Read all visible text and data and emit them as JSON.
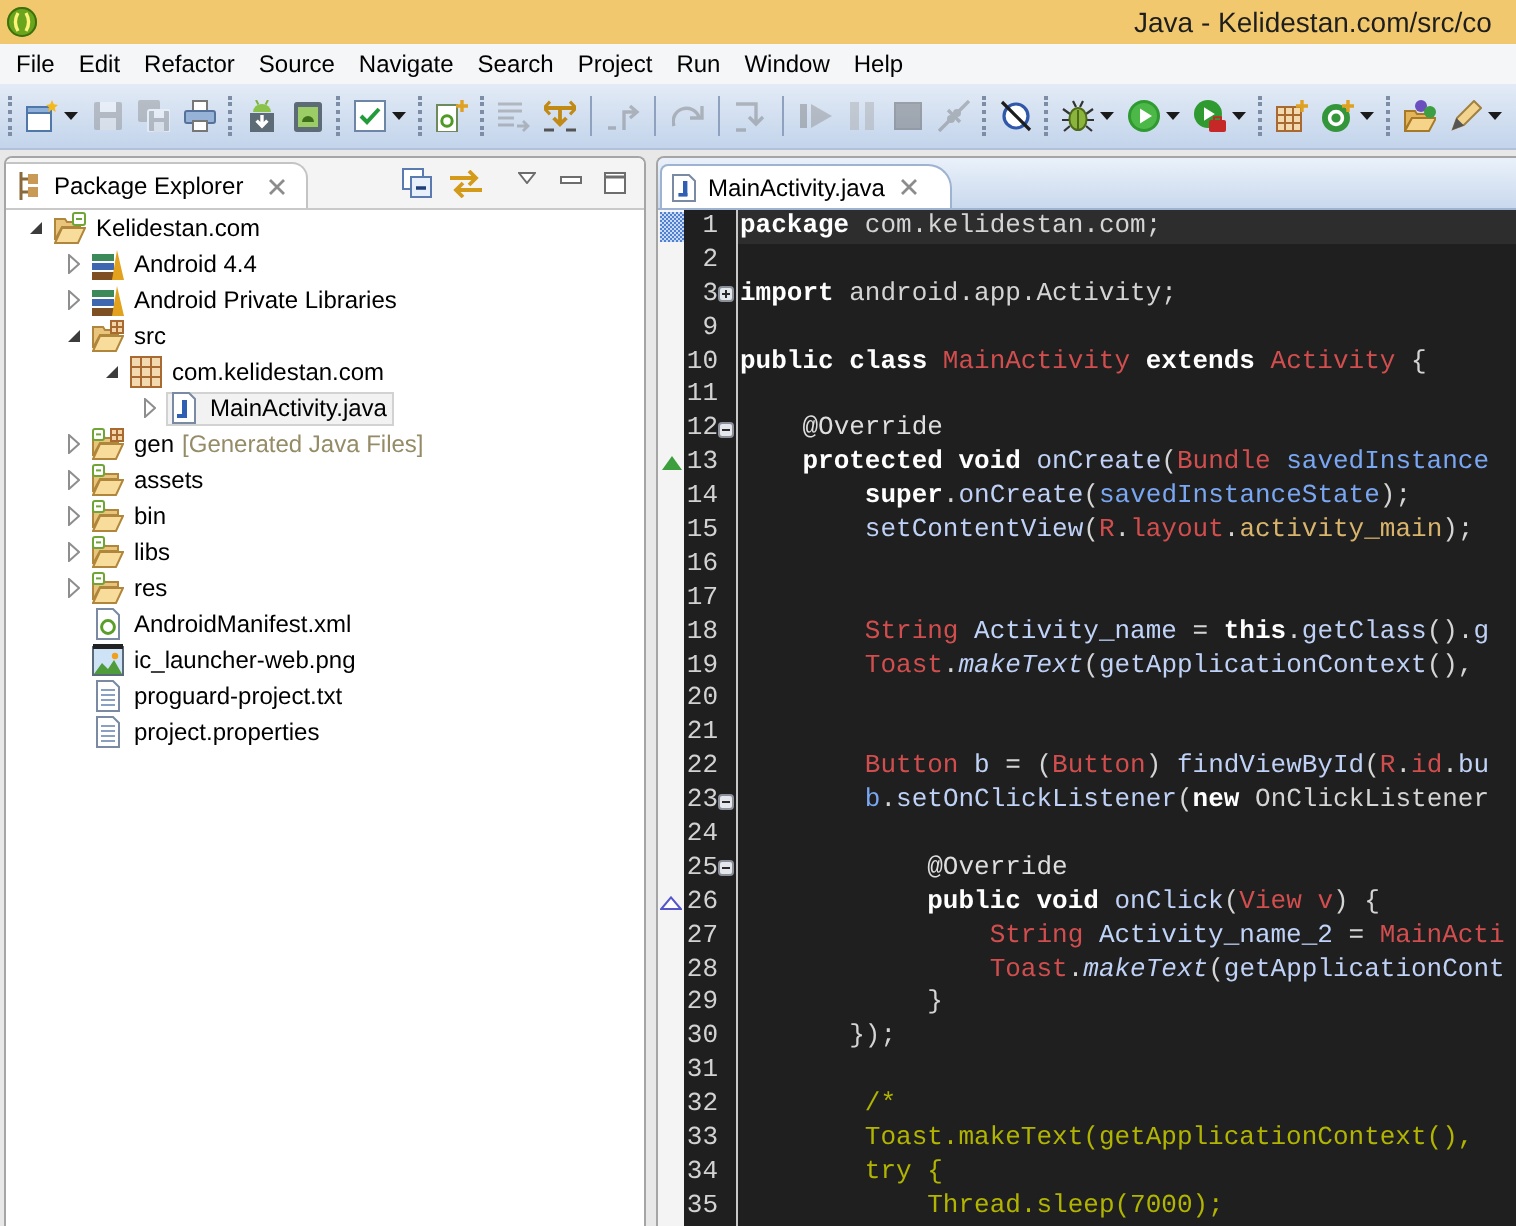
{
  "window": {
    "title": "Java - Kelidestan.com/src/co"
  },
  "menu": [
    "File",
    "Edit",
    "Refactor",
    "Source",
    "Navigate",
    "Search",
    "Project",
    "Run",
    "Window",
    "Help"
  ],
  "toolbar": {
    "groups": [
      {
        "kind": "grip",
        "items": [
          {
            "disabled": false,
            "menu": true
          },
          {
            "disabled": true
          },
          {
            "disabled": true
          },
          {
            "disabled": false
          }
        ]
      },
      {
        "kind": "grip",
        "items": [
          {
            "disabled": false
          },
          {
            "disabled": false
          }
        ]
      },
      {
        "kind": "grip",
        "items": [
          {
            "disabled": false,
            "menu": true
          }
        ]
      },
      {
        "kind": "grip",
        "items": [
          {
            "disabled": false
          }
        ]
      },
      {
        "kind": "grip",
        "items": [
          {
            "disabled": true
          },
          {
            "disabled": false
          }
        ]
      },
      {
        "kind": "line",
        "items": [
          {
            "disabled": true
          }
        ]
      },
      {
        "kind": "line",
        "items": [
          {
            "disabled": true
          }
        ]
      },
      {
        "kind": "line",
        "items": [
          {
            "disabled": true
          }
        ]
      },
      {
        "kind": "line",
        "items": [
          {
            "disabled": true
          },
          {
            "disabled": true
          },
          {
            "disabled": true
          },
          {
            "disabled": true
          }
        ]
      },
      {
        "kind": "grip",
        "items": [
          {
            "disabled": false
          }
        ]
      },
      {
        "kind": "grip",
        "items": [
          {
            "disabled": false,
            "menu": true
          },
          {
            "disabled": false,
            "menu": true
          },
          {
            "disabled": false,
            "menu": true
          }
        ]
      },
      {
        "kind": "grip",
        "items": [
          {
            "disabled": false
          },
          {
            "disabled": false,
            "menu": true
          }
        ]
      },
      {
        "kind": "grip",
        "items": [
          {
            "disabled": false
          },
          {
            "disabled": false,
            "menu": true
          }
        ]
      }
    ]
  },
  "package_explorer": {
    "active": false,
    "tabs": [
      {
        "label": "Package Explorer",
        "selected": true
      }
    ],
    "tree": [
      {
        "label": "Kelidestan.com",
        "kind": "project",
        "expanded": true,
        "selected": false,
        "children": [
          {
            "label": "Android 4.4",
            "kind": "library",
            "expanded": false,
            "selected": false
          },
          {
            "label": "Android Private Libraries",
            "kind": "library",
            "expanded": false,
            "selected": false
          },
          {
            "label": "src",
            "kind": "source-folder",
            "expanded": true,
            "selected": false,
            "children": [
              {
                "label": "com.kelidestan.com",
                "kind": "package",
                "expanded": true,
                "selected": false,
                "children": [
                  {
                    "label": "MainActivity.java",
                    "kind": "java-file",
                    "expanded": false,
                    "selected": true
                  }
                ]
              }
            ]
          },
          {
            "label": "gen",
            "decoration": "[Generated Java Files]",
            "kind": "generated-folder",
            "expanded": false,
            "selected": false
          },
          {
            "label": "assets",
            "kind": "folder",
            "expanded": false,
            "selected": false
          },
          {
            "label": "bin",
            "kind": "folder",
            "expanded": false,
            "selected": false
          },
          {
            "label": "libs",
            "kind": "folder",
            "expanded": false,
            "selected": false
          },
          {
            "label": "res",
            "kind": "folder",
            "expanded": false,
            "selected": false
          },
          {
            "label": "AndroidManifest.xml",
            "kind": "manifest",
            "selected": false
          },
          {
            "label": "ic_launcher-web.png",
            "kind": "image",
            "selected": false
          },
          {
            "label": "proguard-project.txt",
            "kind": "text-file",
            "selected": false
          },
          {
            "label": "project.properties",
            "kind": "text-file",
            "selected": false
          }
        ]
      }
    ]
  },
  "editor": {
    "active": true,
    "tabs": [
      {
        "label": "MainActivity.java",
        "selected": true
      }
    ],
    "lines": [
      {
        "number": "1",
        "kind": "checkered",
        "current": true,
        "tokens": [
          {
            "kind": "keyword",
            "text": "package "
          },
          {
            "kind": "plain",
            "text": "com.kelidestan.com;"
          }
        ]
      },
      {
        "number": "2",
        "kind": "plain",
        "current": false
      },
      {
        "number": "3",
        "kind": "plain",
        "current": false,
        "folded": true,
        "tokens": [
          {
            "kind": "keyword",
            "text": "import "
          },
          {
            "kind": "plain",
            "text": "android.app.Activity;"
          }
        ]
      },
      {
        "number": "9",
        "kind": "plain",
        "current": false
      },
      {
        "number": "10",
        "kind": "plain",
        "current": false,
        "tokens": [
          {
            "kind": "keyword",
            "text": "public "
          },
          {
            "kind": "keyword",
            "text": "class "
          },
          {
            "kind": "type",
            "text": "MainActivity "
          },
          {
            "kind": "keyword",
            "text": "extends "
          },
          {
            "kind": "type",
            "text": "Activity "
          },
          {
            "kind": "plain",
            "text": "{"
          }
        ]
      },
      {
        "number": "11",
        "kind": "plain",
        "current": false
      },
      {
        "number": "12",
        "kind": "plain",
        "current": false,
        "folded": false,
        "tokens": [
          {
            "kind": "annotation",
            "text": "    @Override"
          }
        ]
      },
      {
        "number": "13",
        "kind": "override",
        "current": false,
        "tokens": [
          {
            "kind": "keyword",
            "text": "    protected "
          },
          {
            "kind": "keyword",
            "text": "void "
          },
          {
            "kind": "method",
            "text": "onCreate"
          },
          {
            "kind": "plain",
            "text": "("
          },
          {
            "kind": "type",
            "text": "Bundle "
          },
          {
            "kind": "parameter",
            "text": "savedInstance"
          }
        ]
      },
      {
        "number": "14",
        "kind": "plain",
        "current": false,
        "tokens": [
          {
            "kind": "keyword",
            "text": "        super"
          },
          {
            "kind": "plain",
            "text": "."
          },
          {
            "kind": "method",
            "text": "onCreate"
          },
          {
            "kind": "plain",
            "text": "("
          },
          {
            "kind": "parameter",
            "text": "savedInstanceState"
          },
          {
            "kind": "plain",
            "text": ");"
          }
        ]
      },
      {
        "number": "15",
        "kind": "plain",
        "current": false,
        "tokens": [
          {
            "kind": "method",
            "text": "        setContentView"
          },
          {
            "kind": "plain",
            "text": "("
          },
          {
            "kind": "type",
            "text": "R"
          },
          {
            "kind": "plain",
            "text": "."
          },
          {
            "kind": "field",
            "text": "layout"
          },
          {
            "kind": "plain",
            "text": "."
          },
          {
            "kind": "constant",
            "text": "activity_main"
          },
          {
            "kind": "plain",
            "text": ");"
          }
        ]
      },
      {
        "number": "16",
        "kind": "plain",
        "current": false
      },
      {
        "number": "17",
        "kind": "plain",
        "current": false
      },
      {
        "number": "18",
        "kind": "plain",
        "current": false,
        "tokens": [
          {
            "kind": "type",
            "text": "        String "
          },
          {
            "kind": "local",
            "text": "Activity_name "
          },
          {
            "kind": "plain",
            "text": "= "
          },
          {
            "kind": "keyword",
            "text": "this"
          },
          {
            "kind": "plain",
            "text": "."
          },
          {
            "kind": "method",
            "text": "getClass"
          },
          {
            "kind": "plain",
            "text": "()."
          },
          {
            "kind": "method",
            "text": "g"
          }
        ]
      },
      {
        "number": "19",
        "kind": "plain",
        "current": false,
        "tokens": [
          {
            "kind": "type",
            "text": "        Toast"
          },
          {
            "kind": "plain",
            "text": "."
          },
          {
            "kind": "static_method",
            "text": "makeText"
          },
          {
            "kind": "plain",
            "text": "("
          },
          {
            "kind": "method",
            "text": "getApplicationContext"
          },
          {
            "kind": "plain",
            "text": "(),"
          }
        ]
      },
      {
        "number": "20",
        "kind": "plain",
        "current": false
      },
      {
        "number": "21",
        "kind": "plain",
        "current": false
      },
      {
        "number": "22",
        "kind": "plain",
        "current": false,
        "tokens": [
          {
            "kind": "type",
            "text": "        Button "
          },
          {
            "kind": "local",
            "text": "b "
          },
          {
            "kind": "plain",
            "text": "= ("
          },
          {
            "kind": "type",
            "text": "Button"
          },
          {
            "kind": "plain",
            "text": ") "
          },
          {
            "kind": "method",
            "text": "findViewById"
          },
          {
            "kind": "plain",
            "text": "("
          },
          {
            "kind": "type",
            "text": "R"
          },
          {
            "kind": "plain",
            "text": "."
          },
          {
            "kind": "field",
            "text": "id"
          },
          {
            "kind": "plain",
            "text": "."
          },
          {
            "kind": "local",
            "text": "bu"
          }
        ]
      },
      {
        "number": "23",
        "kind": "plain",
        "current": false,
        "folded": false,
        "tokens": [
          {
            "kind": "parameter",
            "text": "        b"
          },
          {
            "kind": "plain",
            "text": "."
          },
          {
            "kind": "method",
            "text": "setOnClickListener"
          },
          {
            "kind": "plain",
            "text": "("
          },
          {
            "kind": "keyword",
            "text": "new "
          },
          {
            "kind": "plain",
            "text": "OnClickListener"
          }
        ]
      },
      {
        "number": "24",
        "kind": "plain",
        "current": false
      },
      {
        "number": "25",
        "kind": "plain",
        "current": false,
        "folded": false,
        "tokens": [
          {
            "kind": "annotation",
            "text": "            @Override"
          }
        ]
      },
      {
        "number": "26",
        "kind": "implement",
        "current": false,
        "tokens": [
          {
            "kind": "keyword",
            "text": "            public "
          },
          {
            "kind": "keyword",
            "text": "void "
          },
          {
            "kind": "method",
            "text": "onClick"
          },
          {
            "kind": "plain",
            "text": "("
          },
          {
            "kind": "type",
            "text": "View "
          },
          {
            "kind": "type",
            "text": "v"
          },
          {
            "kind": "plain",
            "text": ") {"
          }
        ]
      },
      {
        "number": "27",
        "kind": "plain",
        "current": false,
        "tokens": [
          {
            "kind": "type",
            "text": "                String "
          },
          {
            "kind": "local",
            "text": "Activity_name_2 "
          },
          {
            "kind": "plain",
            "text": "= "
          },
          {
            "kind": "type",
            "text": "MainActi"
          }
        ]
      },
      {
        "number": "28",
        "kind": "plain",
        "current": false,
        "tokens": [
          {
            "kind": "type",
            "text": "                Toast"
          },
          {
            "kind": "plain",
            "text": "."
          },
          {
            "kind": "static_method",
            "text": "makeText"
          },
          {
            "kind": "plain",
            "text": "("
          },
          {
            "kind": "method",
            "text": "getApplicationCont"
          }
        ]
      },
      {
        "number": "29",
        "kind": "plain",
        "current": false,
        "tokens": [
          {
            "kind": "plain",
            "text": "            }"
          }
        ]
      },
      {
        "number": "30",
        "kind": "plain",
        "current": false,
        "tokens": [
          {
            "kind": "plain",
            "text": "       });"
          }
        ]
      },
      {
        "number": "31",
        "kind": "plain",
        "current": false
      },
      {
        "number": "32",
        "kind": "plain",
        "current": false,
        "tokens": [
          {
            "kind": "comment",
            "text": "        /*"
          }
        ]
      },
      {
        "number": "33",
        "kind": "plain",
        "current": false,
        "tokens": [
          {
            "kind": "comment",
            "text": "        Toast.makeText(getApplicationContext(),"
          }
        ]
      },
      {
        "number": "34",
        "kind": "plain",
        "current": false,
        "tokens": [
          {
            "kind": "comment",
            "text": "        try {"
          }
        ]
      },
      {
        "number": "35",
        "kind": "plain",
        "current": false,
        "tokens": [
          {
            "kind": "comment",
            "text": "            Thread.sleep(7000);"
          }
        ]
      }
    ]
  }
}
